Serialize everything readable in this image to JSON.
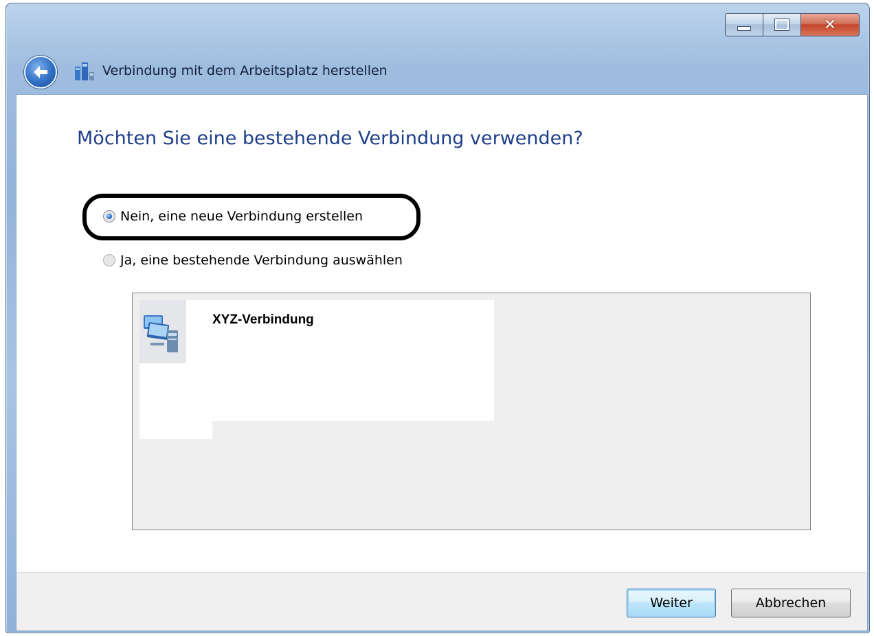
{
  "window": {
    "title": "Verbindung mit dem Arbeitsplatz herstellen",
    "caption_buttons": {
      "minimize_icon": "minimize-icon",
      "maximize_icon": "maximize-icon",
      "close_icon": "close-icon"
    }
  },
  "main": {
    "heading": "Möchten Sie eine bestehende Verbindung verwenden?",
    "options": [
      {
        "label": "Nein, eine neue Verbindung erstellen",
        "checked": true
      },
      {
        "label": "Ja, eine bestehende Verbindung auswählen",
        "checked": false
      }
    ],
    "connections": [
      {
        "name": "XYZ-Verbindung",
        "icon": "network-computer-icon"
      }
    ]
  },
  "footer": {
    "next_label": "Weiter",
    "cancel_label": "Abbrechen"
  },
  "colors": {
    "heading": "#1e3f8a",
    "highlight_outline": "#000000",
    "footer_bg": "#f0f0f0"
  }
}
